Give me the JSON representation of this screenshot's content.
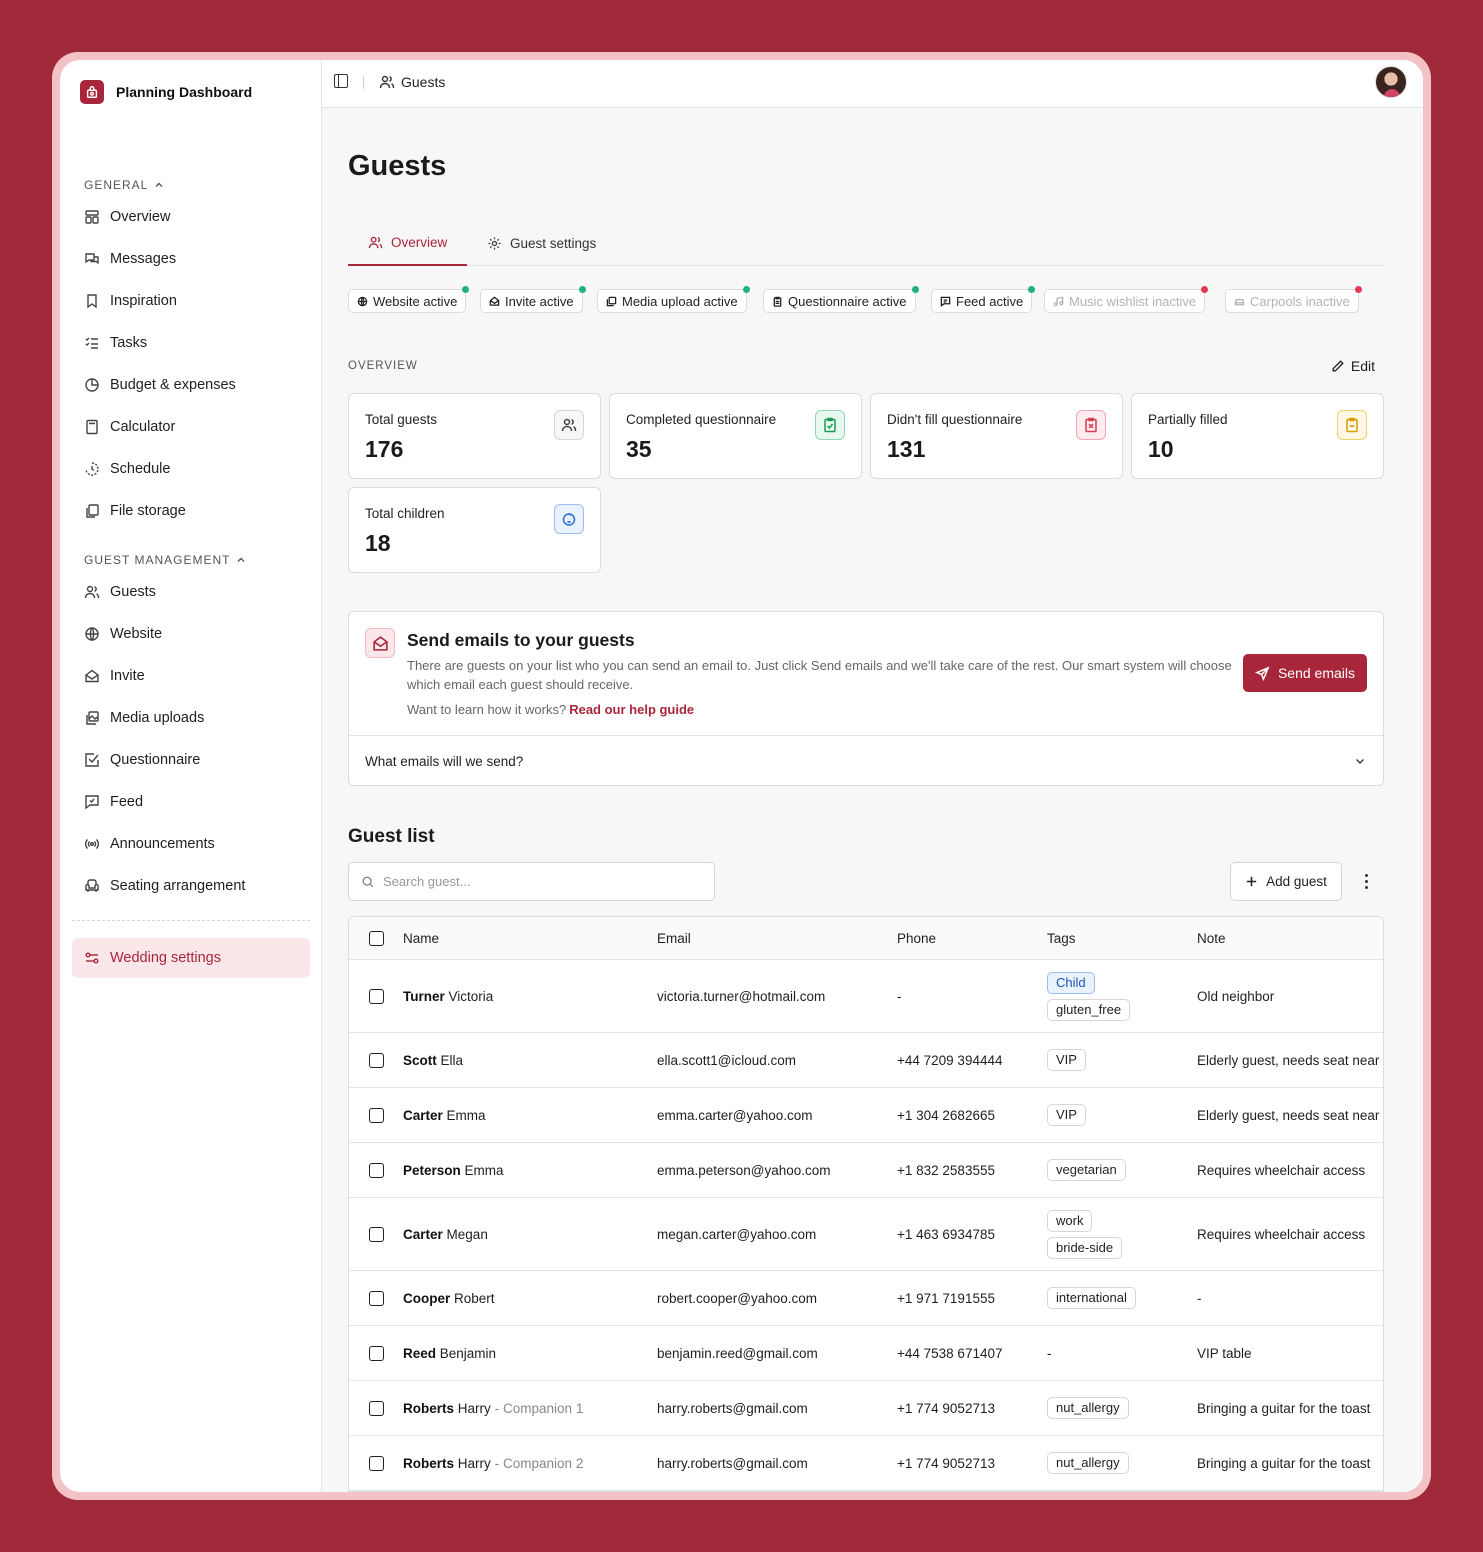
{
  "app": {
    "name": "Planning Dashboard"
  },
  "sidebar": {
    "general_title": "GENERAL",
    "general_items": [
      {
        "label": "Overview",
        "icon": "layout-icon"
      },
      {
        "label": "Messages",
        "icon": "chat-icon"
      },
      {
        "label": "Inspiration",
        "icon": "bookmark-icon"
      },
      {
        "label": "Tasks",
        "icon": "list-check-icon"
      },
      {
        "label": "Budget & expenses",
        "icon": "pie-chart-icon"
      },
      {
        "label": "Calculator",
        "icon": "calculator-icon"
      },
      {
        "label": "Schedule",
        "icon": "clock-icon"
      },
      {
        "label": "File storage",
        "icon": "files-icon"
      }
    ],
    "guest_title": "GUEST MANAGEMENT",
    "guest_items": [
      {
        "label": "Guests",
        "icon": "users-icon"
      },
      {
        "label": "Website",
        "icon": "globe-icon"
      },
      {
        "label": "Invite",
        "icon": "envelope-open-icon"
      },
      {
        "label": "Media uploads",
        "icon": "images-icon"
      },
      {
        "label": "Questionnaire",
        "icon": "check-square-icon"
      },
      {
        "label": "Feed",
        "icon": "message-square-icon"
      },
      {
        "label": "Announcements",
        "icon": "broadcast-icon"
      },
      {
        "label": "Seating arrangement",
        "icon": "armchair-icon"
      }
    ],
    "settings_label": "Wedding settings"
  },
  "topbar": {
    "breadcrumb": "Guests"
  },
  "page": {
    "title": "Guests"
  },
  "tabs": [
    {
      "label": "Overview",
      "active": true
    },
    {
      "label": "Guest settings",
      "active": false
    }
  ],
  "status_chips": [
    {
      "label": "Website active",
      "active": true
    },
    {
      "label": "Invite active",
      "active": true
    },
    {
      "label": "Media upload active",
      "active": true
    },
    {
      "label": "Questionnaire active",
      "active": true
    },
    {
      "label": "Feed active",
      "active": true
    },
    {
      "label": "Music wishlist inactive",
      "active": false
    },
    {
      "label": "Carpools inactive",
      "active": false
    }
  ],
  "overview": {
    "label": "OVERVIEW",
    "edit_label": "Edit",
    "stats": [
      {
        "label": "Total guests",
        "value": "176",
        "icon": "users-icon"
      },
      {
        "label": "Completed questionnaire",
        "value": "35",
        "icon": "clipboard-check-icon"
      },
      {
        "label": "Didn't fill questionnaire",
        "value": "131",
        "icon": "clipboard-x-icon"
      },
      {
        "label": "Partially filled",
        "value": "10",
        "icon": "clipboard-minus-icon"
      },
      {
        "label": "Total children",
        "value": "18",
        "icon": "baby-icon"
      }
    ]
  },
  "email_card": {
    "title": "Send emails to your guests",
    "description": "There are guests on your list who you can send an email to. Just click Send emails and we'll take care of the rest. Our smart system will choose which email each guest should receive.",
    "help_prefix": "Want to learn how it works?",
    "help_link": "Read our help guide",
    "button": "Send emails",
    "accordion": "What emails will we send?"
  },
  "guest_list": {
    "title": "Guest list",
    "search_placeholder": "Search guest...",
    "add_button": "Add guest",
    "columns": {
      "name": "Name",
      "email": "Email",
      "phone": "Phone",
      "tags": "Tags",
      "note": "Note"
    },
    "rows": [
      {
        "last": "Turner",
        "first": "Victoria",
        "companion": "",
        "email": "victoria.turner@hotmail.com",
        "phone": "-",
        "tags": [
          "Child",
          "gluten_free"
        ],
        "note": "Old neighbor"
      },
      {
        "last": "Scott",
        "first": "Ella",
        "companion": "",
        "email": "ella.scott1@icloud.com",
        "phone": "+44 7209 394444",
        "tags": [
          "VIP"
        ],
        "note": "Elderly guest, needs seat near"
      },
      {
        "last": "Carter",
        "first": "Emma",
        "companion": "",
        "email": "emma.carter@yahoo.com",
        "phone": "+1 304 2682665",
        "tags": [
          "VIP"
        ],
        "note": "Elderly guest, needs seat near"
      },
      {
        "last": "Peterson",
        "first": "Emma",
        "companion": "",
        "email": "emma.peterson@yahoo.com",
        "phone": "+1 832 2583555",
        "tags": [
          "vegetarian"
        ],
        "note": "Requires wheelchair access"
      },
      {
        "last": "Carter",
        "first": "Megan",
        "companion": "",
        "email": "megan.carter@yahoo.com",
        "phone": "+1 463 6934785",
        "tags": [
          "work",
          "bride-side"
        ],
        "note": "Requires wheelchair access"
      },
      {
        "last": "Cooper",
        "first": "Robert",
        "companion": "",
        "email": "robert.cooper@yahoo.com",
        "phone": "+1 971 7191555",
        "tags": [
          "international"
        ],
        "note": "-"
      },
      {
        "last": "Reed",
        "first": "Benjamin",
        "companion": "",
        "email": "benjamin.reed@gmail.com",
        "phone": "+44 7538 671407",
        "tags": [],
        "tags_empty": "-",
        "note": "VIP table"
      },
      {
        "last": "Roberts",
        "first": "Harry",
        "companion": "- Companion 1",
        "email": "harry.roberts@gmail.com",
        "phone": "+1 774 9052713",
        "tags": [
          "nut_allergy"
        ],
        "note": "Bringing a guitar for the toast"
      },
      {
        "last": "Roberts",
        "first": "Harry",
        "companion": "- Companion 2",
        "email": "harry.roberts@gmail.com",
        "phone": "+1 774 9052713",
        "tags": [
          "nut_allergy"
        ],
        "note": "Bringing a guitar for the toast"
      }
    ]
  },
  "colors": {
    "brand": "#a8263a",
    "active_dot": "#1fb27a",
    "inactive_dot": "#e53953",
    "background": "#a02a3a"
  }
}
